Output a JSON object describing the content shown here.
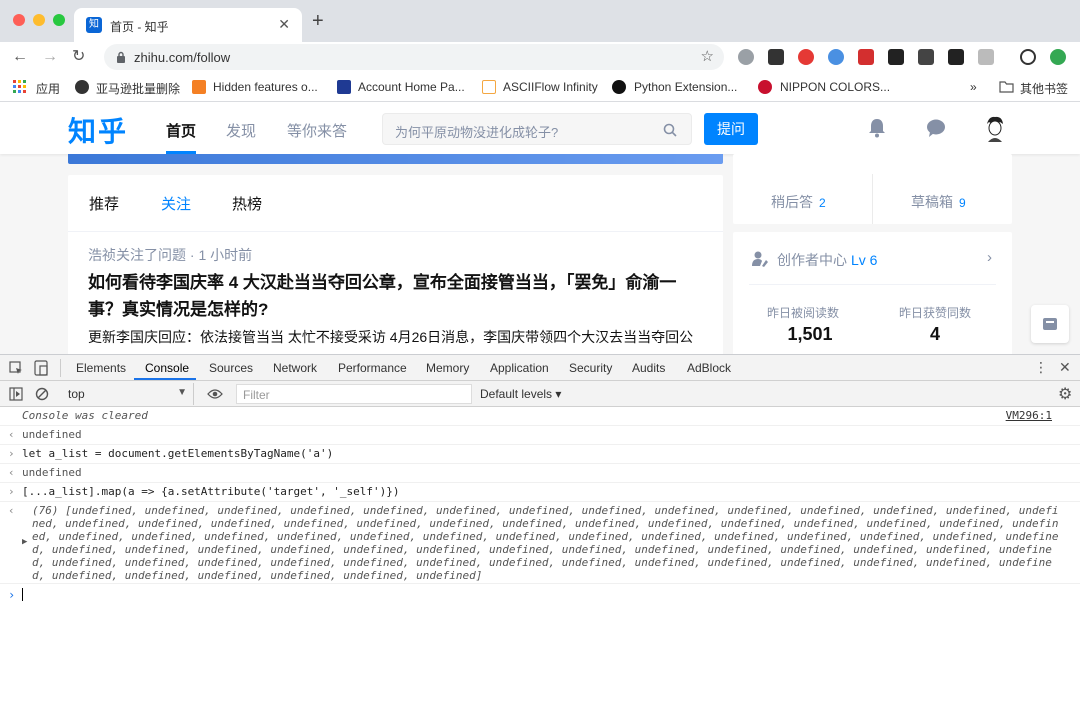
{
  "browser": {
    "tab": {
      "favicon_text": "知",
      "title": "首页 - 知乎"
    },
    "url": "zhihu.com/follow",
    "bookmarks": [
      {
        "label": "应用",
        "color": "#e94235"
      },
      {
        "label": "亚马逊批量删除",
        "color": "#333333"
      },
      {
        "label": "Hidden features o...",
        "color": "#f48024"
      },
      {
        "label": "Account Home Pa...",
        "color": "#1f3a93"
      },
      {
        "label": "ASCIIFlow Infinity",
        "color": "#f4a742"
      },
      {
        "label": "Python Extension...",
        "color": "#111111"
      },
      {
        "label": "NIPPON COLORS...",
        "color": "#c8102e"
      }
    ],
    "bookmarks_more": "»",
    "other_bookmarks": "其他书签"
  },
  "zhihu": {
    "logo": "知乎",
    "nav": [
      "首页",
      "发现",
      "等你来答"
    ],
    "search_placeholder": "为何平原动物没进化成轮子?",
    "ask_button": "提问",
    "feed_tabs": [
      "推荐",
      "关注",
      "热榜"
    ],
    "item": {
      "meta": "浩祯关注了问题 · 1 小时前",
      "title": "如何看待李国庆率 4 大汉赴当当夺回公章，宣布全面接管当当，「罢免」俞渝一事？真实情况是怎样的?",
      "excerpt": "更新李国庆回应：依法接管当当 太忙不接受采访 4月26日消息，李国庆带领四个大汉去当当夺回公"
    },
    "side": {
      "later_answer": "稍后答",
      "later_count": "2",
      "drafts": "草稿箱",
      "drafts_count": "9",
      "creator_center": "创作者中心",
      "level": "Lv 6",
      "read_label": "昨日被阅读数",
      "read_value": "1,501",
      "like_label": "昨日获赞同数",
      "like_value": "4"
    }
  },
  "devtools": {
    "tabs": [
      "Elements",
      "Console",
      "Sources",
      "Network",
      "Performance",
      "Memory",
      "Application",
      "Security",
      "Audits",
      "AdBlock"
    ],
    "context": "top",
    "filter_placeholder": "Filter",
    "levels": "Default levels ▾",
    "lines": {
      "cleared": "Console was cleared",
      "vm": "VM296:1",
      "undefined1": "undefined",
      "cmd1": "let a_list = document.getElementsByTagName('a')",
      "undefined2": "undefined",
      "cmd2": "[...a_list].map(a => {a.setAttribute('target', '_self')})",
      "result": "(76) [undefined, undefined, undefined, undefined, undefined, undefined, undefined, undefined, undefined, undefined, undefined, undefined, undefined, undefined, undefined, undefined, undefined, undefined, undefined, undefined, undefined, undefined, undefined, undefined, undefined, undefined, undefined, undefined, undefined, undefined, undefined, undefined, undefined, undefined, undefined, undefined, undefined, undefined, undefined, undefined, undefined, undefined, undefined, undefined, undefined, undefined, undefined, undefined, undefined, undefined, undefined, undefined, undefined, undefined, undefined, undefined, undefined, undefined, undefined, undefined, undefined, undefined, undefined, undefined, undefined, undefined, undefined, undefined, undefined, undefined, undefined, undefined, undefined, undefined, undefined, undefined]"
    }
  }
}
